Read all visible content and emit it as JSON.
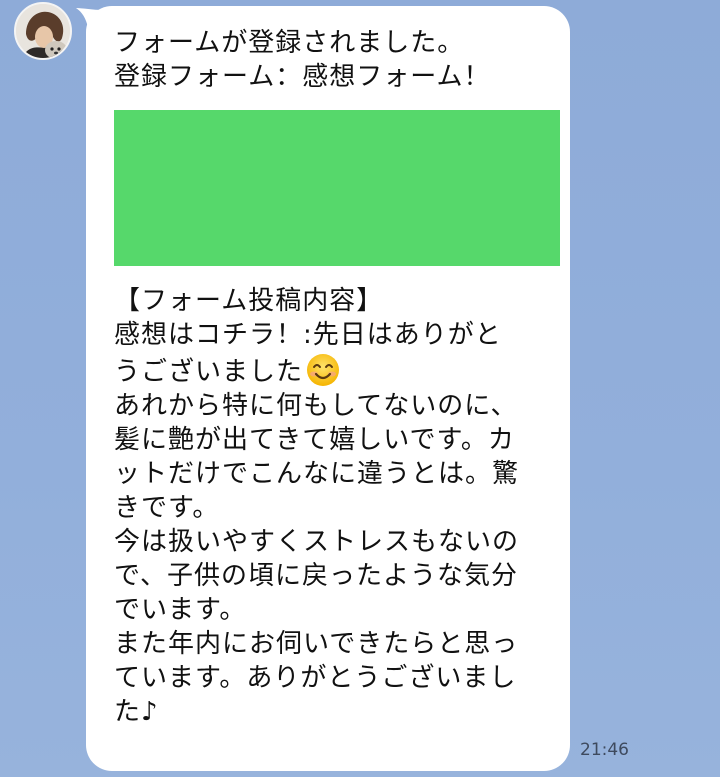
{
  "message": {
    "header_lines": [
      "フォームが登録されました。",
      "登録フォーム：感想フォーム！"
    ],
    "content_lines": [
      "【フォーム投稿内容】",
      "感想はコチラ！:先日はありがと",
      "うございました",
      "あれから特に何もしてないのに、",
      "髪に艶が出てきて嬉しいです。カ",
      "ットだけでこんなに違うとは。驚",
      "きです。",
      "今は扱いやすくストレスもないの",
      "で、子供の頃に戻ったような気分",
      "でいます。",
      "また年内にお伺いできたらと思っ",
      "ています。ありがとうございまし",
      "た♪"
    ],
    "emoji_icon": "smiling-face-emoji",
    "timestamp": "21:46",
    "redacted_block_color": "#56d86b"
  },
  "colors": {
    "chat_background": "#8facd8",
    "bubble": "#ffffff",
    "timestamp": "#3e4a5e"
  }
}
